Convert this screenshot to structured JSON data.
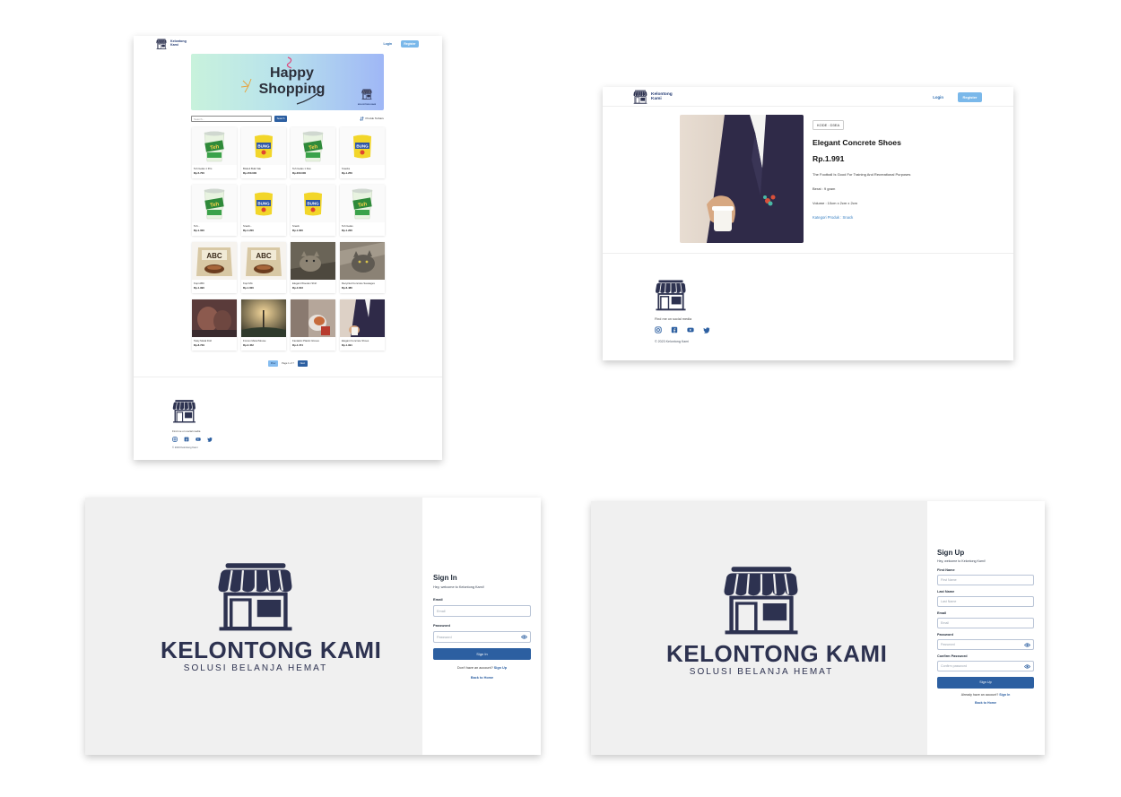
{
  "brand": {
    "line1": "Kelontong",
    "line2": "Kami",
    "full": "KELONTONG KAMI",
    "tagline": "SOLUSI BELANJA HEMAT",
    "navy": "#2d3250",
    "accent": "#2c5fa1"
  },
  "nav": {
    "login": "Login",
    "register": "Register"
  },
  "catalog": {
    "banner": {
      "line1": "Happy",
      "line2": "Shopping"
    },
    "search_placeholder": "Search...",
    "search_button": "Search",
    "sort_label": "Produk Terbaru",
    "products": [
      {
        "name": "Teh Gelas 1 Pcs",
        "price": "Rp.5.700",
        "img": "tehgelas"
      },
      {
        "name": "Biskuit Bulk Vak",
        "price": "Rp.150.000",
        "img": "snack"
      },
      {
        "name": "Teh Gelas 1 Dus",
        "price": "Rp.200.000",
        "img": "tehgelas"
      },
      {
        "name": "Snacks",
        "price": "Rp.1.250",
        "img": "snack"
      },
      {
        "name": "Teh...",
        "price": "Rp.1.000",
        "img": "tehgelas"
      },
      {
        "name": "Snack...",
        "price": "Rp.1.200",
        "img": "snack"
      },
      {
        "name": "Snack",
        "price": "Rp.1.000",
        "img": "snack"
      },
      {
        "name": "Teh Gelas",
        "price": "Rp.1.200",
        "img": "tehgelas"
      },
      {
        "name": "Kopi ABC",
        "price": "Rp.1.990",
        "img": "abc"
      },
      {
        "name": "Kopi Mix",
        "price": "Rp.1.000",
        "img": "abc"
      },
      {
        "name": "Elegant Wooden Shirt",
        "price": "Rp.4.643",
        "img": "cat1"
      },
      {
        "name": "Recycled Concrete Sausages",
        "price": "Rp.6.480",
        "img": "cat2"
      },
      {
        "name": "Tasty Metal Fish",
        "price": "Rp.8.729",
        "img": "photo1"
      },
      {
        "name": "Frozen Metal Mouse",
        "price": "Rp.2.452",
        "img": "photo2"
      },
      {
        "name": "Fantastic Plastic Gloves",
        "price": "Rp.4.474",
        "img": "photo3"
      },
      {
        "name": "Elegant Concrete Shoes",
        "price": "Rp.1.991",
        "img": "suit"
      }
    ],
    "pager": {
      "prev": "Prev",
      "text": "Page 1 of 7",
      "next": "Next"
    }
  },
  "footer": {
    "text": "Find me on social media",
    "copyright": "© 2023 Kelontong Kami",
    "icons": [
      "instagram-icon",
      "facebook-icon",
      "youtube-icon",
      "twitter-icon"
    ]
  },
  "detail": {
    "kode": "KODE : D3EA",
    "title": "Elegant Concrete Shoes",
    "price": "Rp.1.991",
    "description": "The Football Is Good For Training And Recreational Purposes",
    "berat": "Berat : 9 gram",
    "volume": "Volume : 10cm x 2cm x 2cm",
    "kategori": "Kategori Produk : Snack"
  },
  "signin": {
    "title": "Sign In",
    "subtitle": "Hey, welcome to Kelontong Kami!",
    "email_label": "Email",
    "email_placeholder": "Email",
    "password_label": "Password",
    "password_placeholder": "Password",
    "button": "Sign In",
    "alt_text": "Don't have an account?",
    "alt_link": "Sign Up",
    "back": "Back to Home"
  },
  "signup": {
    "title": "Sign Up",
    "subtitle": "Hey, welcome to Kelontong Kami!",
    "first_label": "First Name",
    "first_placeholder": "First Name",
    "last_label": "Last Name",
    "last_placeholder": "Last Name",
    "email_label": "Email",
    "email_placeholder": "Email",
    "password_label": "Password",
    "password_placeholder": "Password",
    "confirm_label": "Confirm Password",
    "confirm_placeholder": "Confirm password",
    "button": "Sign Up",
    "alt_text": "Already have an account?",
    "alt_link": "Sign In",
    "back": "Back to Home"
  }
}
